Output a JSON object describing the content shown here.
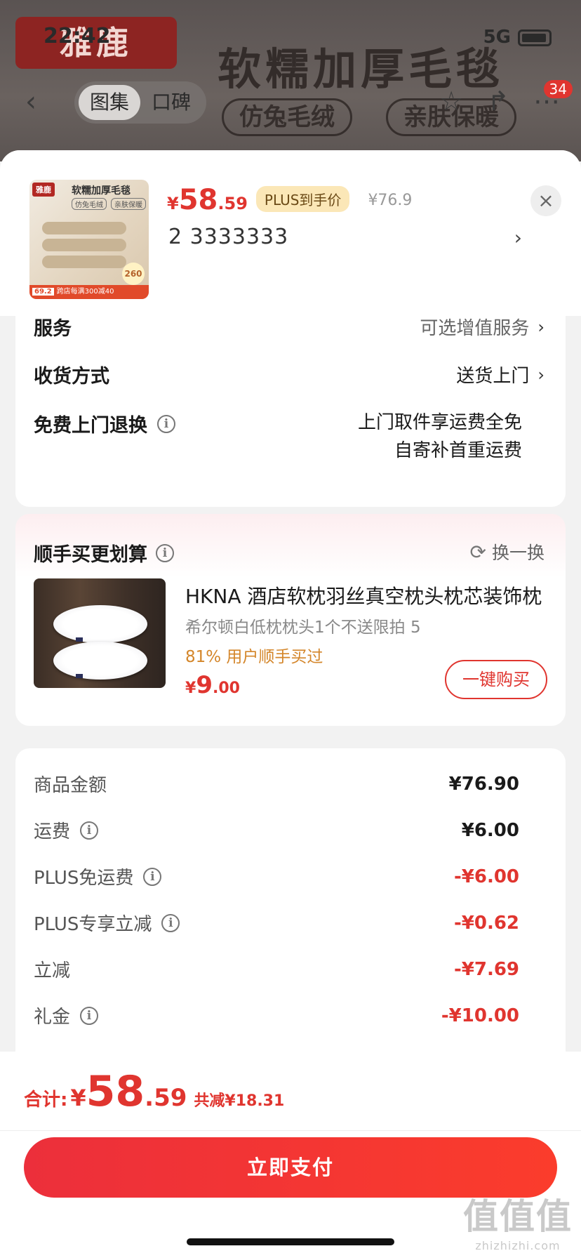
{
  "status_bar": {
    "time": "22:42",
    "network": "5G"
  },
  "background": {
    "brand": "雅鹿",
    "headline": "软糯加厚毛毯",
    "pills": [
      "仿兔毛绒",
      "亲肤保暖"
    ],
    "tabs": [
      "图集",
      "口碑"
    ],
    "cart_badge": "34"
  },
  "sheet": {
    "thumbnail": {
      "brand": "雅鹿",
      "title": "软糯加厚毛毯",
      "tags": [
        "仿兔毛绒",
        "亲肤保暖"
      ],
      "gsm": "260",
      "bar_price": "69.2",
      "bar_text": "跨店每满300减40"
    },
    "price": {
      "symbol": "¥",
      "integer": "58",
      "decimal": ".59"
    },
    "plus_tag": "PLUS到手价",
    "original_price": "¥76.9",
    "spec": "2  3333333",
    "close_icon": "×"
  },
  "services": {
    "rows": [
      {
        "label": "服务",
        "value": "可选增值服务"
      },
      {
        "label": "收货方式",
        "value": "送货上门"
      }
    ],
    "return": {
      "label": "免费上门退换",
      "line1": "上门取件享运费全免",
      "line2": "自寄补首重运费"
    }
  },
  "bundle": {
    "title": "顺手买更划算",
    "swap": "换一换",
    "name": "HKNA 酒店软枕羽丝真空枕头枕芯装饰枕",
    "subtitle": "希尔顿白低枕枕头1个不送限拍 5",
    "bought": "81% 用户顺手买过",
    "price": {
      "symbol": "¥",
      "integer": "9",
      "decimal": ".00"
    },
    "buy_label": "一键购买"
  },
  "breakdown": {
    "rows": [
      {
        "label": "商品金额",
        "value": "¥76.90",
        "info": false,
        "highlight": false
      },
      {
        "label": "运费",
        "value": "¥6.00",
        "info": true,
        "highlight": false
      },
      {
        "label": "PLUS免运费",
        "value": "-¥6.00",
        "info": true,
        "highlight": true
      },
      {
        "label": "PLUS专享立减",
        "value": "-¥0.62",
        "info": true,
        "highlight": true
      },
      {
        "label": "立减",
        "value": "-¥7.69",
        "info": false,
        "highlight": true
      },
      {
        "label": "礼金",
        "value": "-¥10.00",
        "info": true,
        "highlight": true
      }
    ]
  },
  "footer": {
    "total_label": "合计:",
    "total": {
      "symbol": "¥",
      "integer": "58",
      "decimal": ".59"
    },
    "saving": "共减¥18.31",
    "pay_label": "立即支付"
  },
  "watermark": {
    "big": "值值值",
    "small": "zhizhizhi.com"
  },
  "colors": {
    "accent": "#e0352f",
    "plus_tag_bg": "#fbe7b7",
    "bought_text": "#d4862a"
  }
}
